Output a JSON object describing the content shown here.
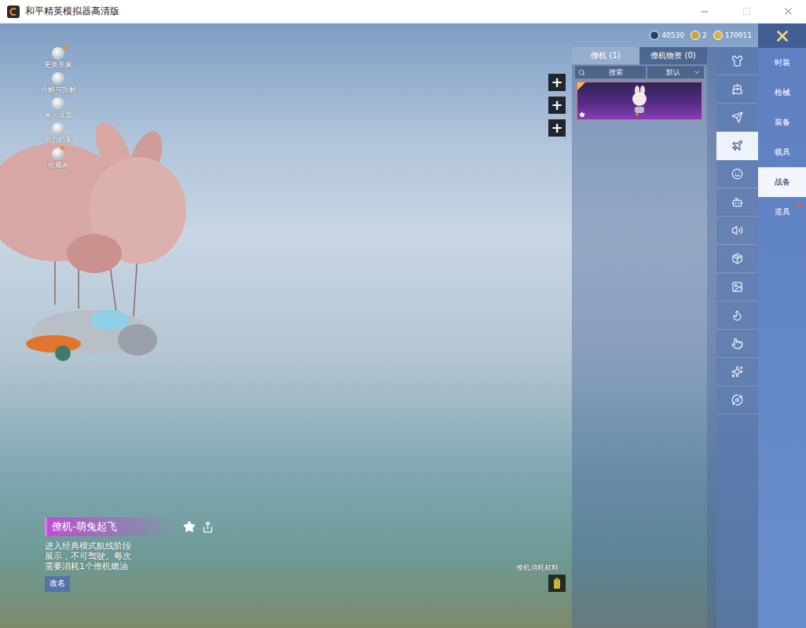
{
  "window": {
    "title": "和平精英模拟器高清版"
  },
  "currencies": [
    {
      "amount": "40530",
      "color": "#2b3f6b"
    },
    {
      "amount": "2",
      "color": "#c9a23a"
    },
    {
      "amount": "170911",
      "color": "#d8b44a"
    }
  ],
  "side_menu": [
    {
      "label": "更换形象",
      "badge": true
    },
    {
      "label": "分解与拆解",
      "badge": false
    },
    {
      "label": "展示设置",
      "badge": false
    },
    {
      "label": "热力档案",
      "badge": false
    },
    {
      "label": "收藏家",
      "badge": true
    }
  ],
  "add_buttons": [
    "+",
    "+",
    "+"
  ],
  "panel": {
    "tabs": [
      {
        "label": "僚机 (1)",
        "selected": true
      },
      {
        "label": "僚机物资 (0)",
        "selected": false
      }
    ],
    "search": {
      "placeholder": "搜索"
    },
    "sort": {
      "value": "默认"
    },
    "items": [
      {
        "selected": true,
        "favorite": true
      }
    ]
  },
  "icon_rail": [
    {
      "selected": false
    },
    {
      "selected": false
    },
    {
      "selected": false
    },
    {
      "selected": true
    },
    {
      "selected": false
    },
    {
      "selected": false
    },
    {
      "selected": false
    },
    {
      "selected": false
    },
    {
      "selected": false
    },
    {
      "selected": false
    },
    {
      "selected": false
    },
    {
      "selected": false
    },
    {
      "selected": false
    }
  ],
  "categories": [
    {
      "label": "时装",
      "selected": false,
      "badge": false
    },
    {
      "label": "枪械",
      "selected": false,
      "badge": false
    },
    {
      "label": "装备",
      "selected": false,
      "badge": false
    },
    {
      "label": "载具",
      "selected": false,
      "badge": false
    },
    {
      "label": "战备",
      "selected": true,
      "badge": false
    },
    {
      "label": "道具",
      "selected": false,
      "badge": true
    }
  ],
  "wingman": {
    "name": "僚机-萌兔起飞",
    "description": "进入经典模式航线阶段展示，不可驾驶。每次需要消耗1个僚机燃油",
    "rename": "改名"
  },
  "materials": {
    "label": "僚机消耗材料："
  }
}
